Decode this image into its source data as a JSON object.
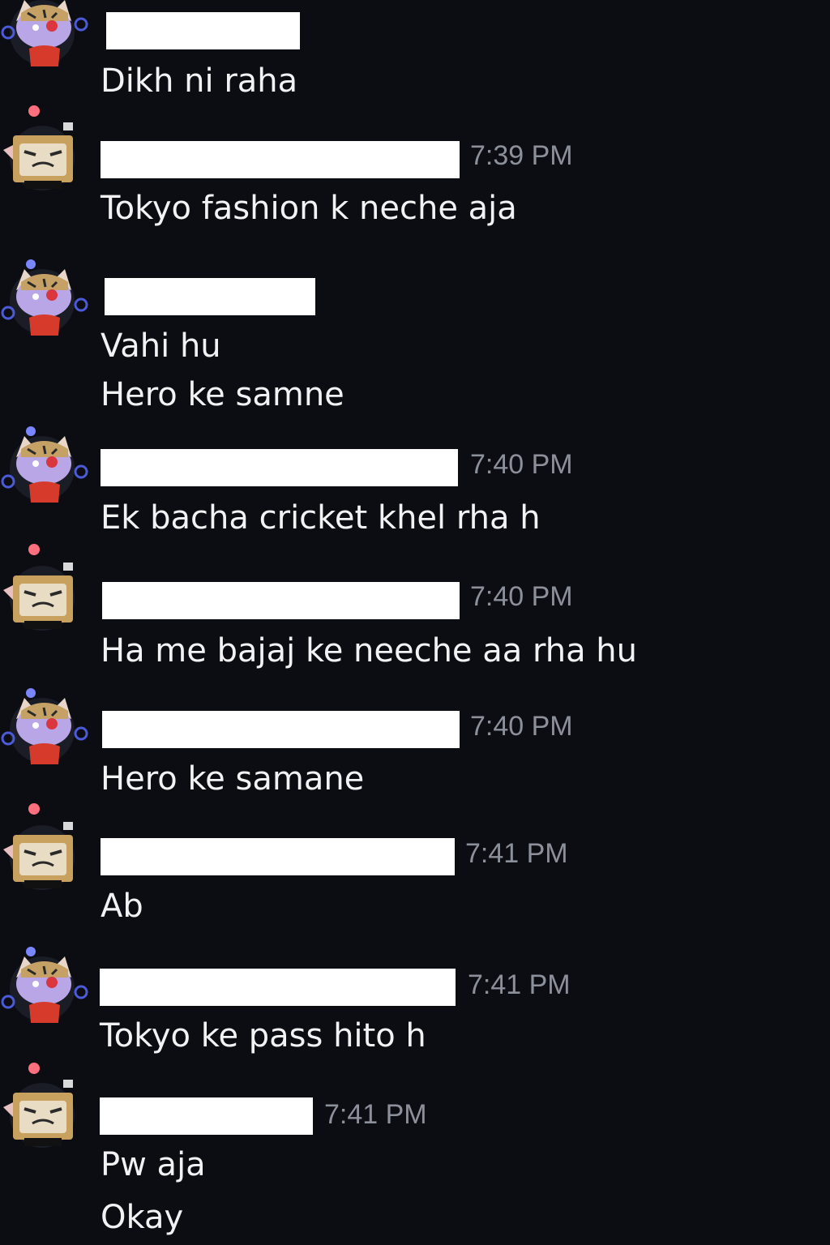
{
  "messages": [
    {
      "user": "A",
      "avatar_icon": "robot-cat-avatar-icon",
      "username_redacted": true,
      "time": "",
      "lines": [
        "Dikh ni raha"
      ]
    },
    {
      "user": "B",
      "avatar_icon": "box-cat-avatar-icon",
      "username_redacted": true,
      "time": "7:39 PM",
      "lines": [
        "Tokyo fashion k neche aja"
      ]
    },
    {
      "user": "A",
      "avatar_icon": "robot-cat-avatar-icon",
      "username_redacted": true,
      "time": "",
      "lines": [
        "Vahi hu",
        "Hero ke samne"
      ]
    },
    {
      "user": "A",
      "avatar_icon": "robot-cat-avatar-icon",
      "username_redacted": true,
      "time": "7:40 PM",
      "lines": [
        "Ek bacha cricket khel rha h"
      ]
    },
    {
      "user": "B",
      "avatar_icon": "box-cat-avatar-icon",
      "username_redacted": true,
      "time": "7:40 PM",
      "lines": [
        "Ha me bajaj ke neeche aa rha hu"
      ]
    },
    {
      "user": "A",
      "avatar_icon": "robot-cat-avatar-icon",
      "username_redacted": true,
      "time": "7:40 PM",
      "lines": [
        "Hero ke samane"
      ]
    },
    {
      "user": "B",
      "avatar_icon": "box-cat-avatar-icon",
      "username_redacted": true,
      "time": "7:41 PM",
      "lines": [
        "Ab"
      ]
    },
    {
      "user": "A",
      "avatar_icon": "robot-cat-avatar-icon",
      "username_redacted": true,
      "time": "7:41 PM",
      "lines": [
        "Tokyo ke pass hito h"
      ]
    },
    {
      "user": "B",
      "avatar_icon": "box-cat-avatar-icon",
      "username_redacted": true,
      "time": "7:41 PM",
      "lines": [
        "Pw aja",
        "Okay"
      ]
    }
  ],
  "colors": {
    "background": "#0c0d12",
    "message_text": "#f2f2f4",
    "timestamp_text": "#8c909a",
    "redaction": "#ffffff"
  }
}
